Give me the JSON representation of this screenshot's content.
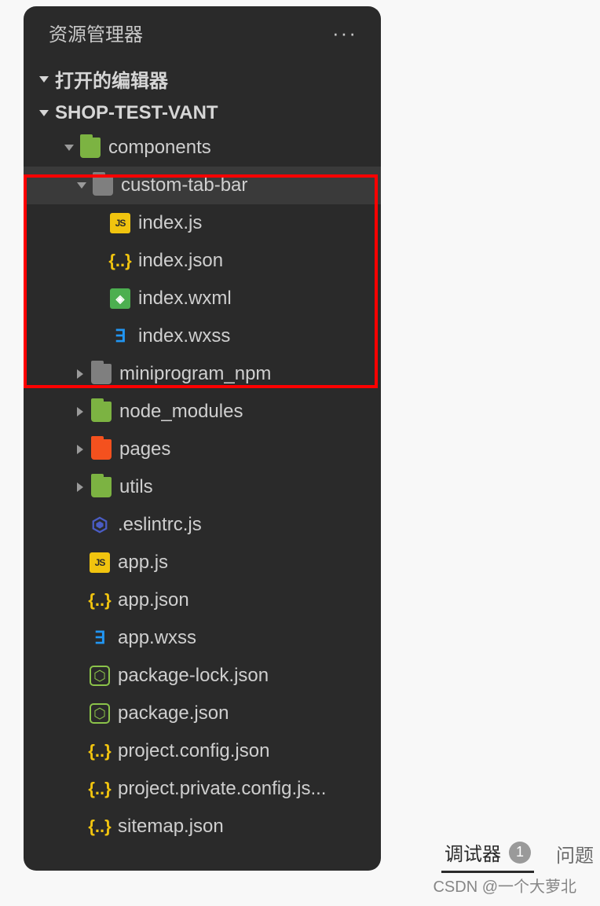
{
  "panel": {
    "title": "资源管理器",
    "more_icon": "···"
  },
  "sections": {
    "open_editors_label": "打开的编辑器",
    "project_label": "SHOP-TEST-VANT"
  },
  "tree": {
    "components": "components",
    "custom_tab_bar": "custom-tab-bar",
    "index_js": "index.js",
    "index_json": "index.json",
    "index_wxml": "index.wxml",
    "index_wxss": "index.wxss",
    "miniprogram_npm": "miniprogram_npm",
    "node_modules": "node_modules",
    "pages": "pages",
    "utils": "utils",
    "eslintrc": ".eslintrc.js",
    "app_js": "app.js",
    "app_json": "app.json",
    "app_wxss": "app.wxss",
    "package_lock": "package-lock.json",
    "package_json": "package.json",
    "project_config": "project.config.json",
    "project_private": "project.private.config.js...",
    "sitemap": "sitemap.json"
  },
  "icon_glyphs": {
    "js": "JS",
    "json": "{..}",
    "wxml": "◈",
    "wxss": "∃",
    "npm": "⬡"
  },
  "bottom": {
    "debugger_label": "调试器",
    "debugger_badge": "1",
    "problems_label": "问题"
  },
  "watermark": "CSDN @一个大萝北"
}
